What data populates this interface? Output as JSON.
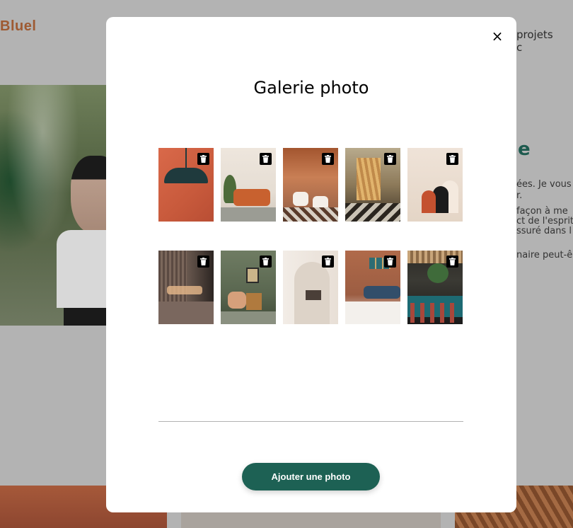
{
  "background": {
    "logo": "Bluel",
    "nav_item_1": "projets",
    "nav_item_2": "c",
    "heading_fragment": "e",
    "para_lines": [
      "ées. Je vous",
      "r.",
      "façon à me",
      "ct de l'esprit",
      "ssuré dans l",
      "naire peut-ê"
    ]
  },
  "modal": {
    "close_glyph": "×",
    "title": "Galerie photo",
    "add_button_label": "Ajouter une photo",
    "photos": [
      {
        "alt": "orange-room-with-lamp"
      },
      {
        "alt": "living-room-orange-sofa"
      },
      {
        "alt": "restaurant-wood-roof"
      },
      {
        "alt": "lobby-with-wood-screen"
      },
      {
        "alt": "beige-interior-arches"
      },
      {
        "alt": "dark-kitchen-slats"
      },
      {
        "alt": "green-living-room"
      },
      {
        "alt": "white-arched-niche"
      },
      {
        "alt": "terracotta-lounge"
      },
      {
        "alt": "teal-bar-restaurant"
      }
    ]
  },
  "colors": {
    "accent_green": "#1d6154",
    "logo_brown": "#9e5a32",
    "overlay_gray": "#b3b3b3"
  }
}
